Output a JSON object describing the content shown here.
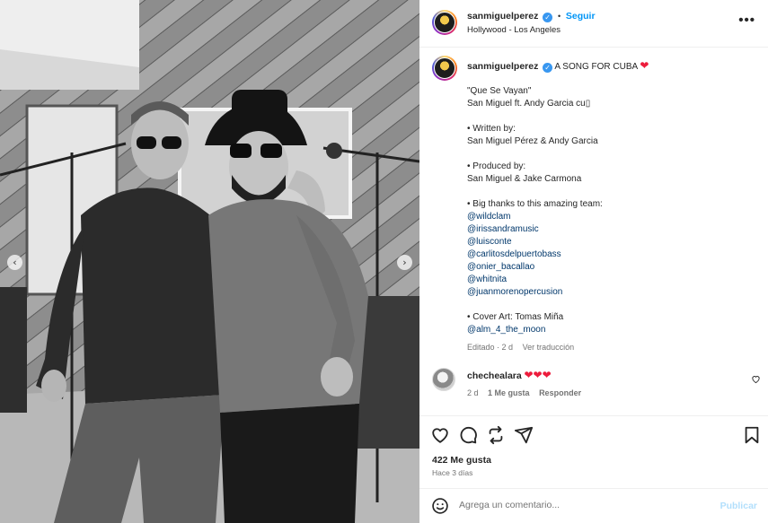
{
  "post": {
    "username": "sanmiguelperez",
    "follow_label": "Seguir",
    "separator": "•",
    "location": "Hollywood - Los Angeles",
    "more_label": "•••"
  },
  "caption": {
    "username": "sanmiguelperez",
    "headline": "A SONG FOR CUBA",
    "lines": [
      "\"Que Se Vayan\"",
      "San Miguel ft. Andy Garcia cu▯",
      "• Written by:",
      "San Miguel Pérez & Andy Garcia",
      "• Produced by:",
      "San Miguel & Jake Carmona",
      "• Big thanks to this amazing team:",
      "• Cover Art: Tomas Miña"
    ],
    "mentions": [
      "@wildclam",
      "@irissandramusic",
      "@luisconte",
      "@carlitosdelpuertobass",
      "@onier_bacallao",
      "@whitnita",
      "@juanmorenopercusion"
    ],
    "art_mention": "@alm_4_the_moon",
    "edited": "Editado · 2 d",
    "translate": "Ver traducción"
  },
  "comment": {
    "username": "chechealara",
    "text": "❤❤❤",
    "time": "2 d",
    "likes": "1 Me gusta",
    "reply": "Responder"
  },
  "stats": {
    "likes": "422 Me gusta",
    "time": "Hace 3 días"
  },
  "composer": {
    "placeholder": "Agrega un comentario...",
    "publish": "Publicar"
  },
  "carousel": {
    "prev": "‹",
    "next": "›"
  },
  "colors": {
    "accent": "#0095f6",
    "link": "#00376b",
    "heart": "#ed1c3c",
    "muted": "#737373"
  }
}
